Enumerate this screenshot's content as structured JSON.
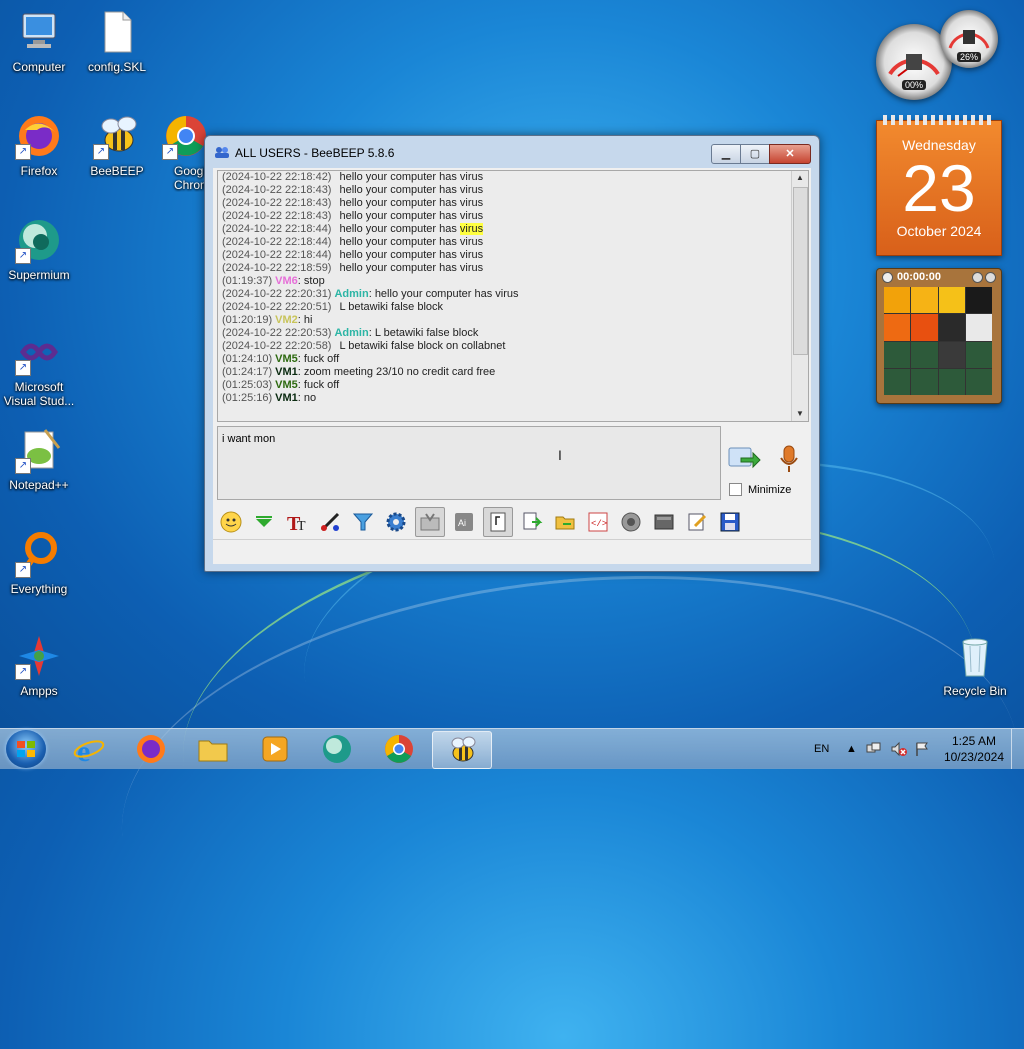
{
  "desktop": {
    "icons": [
      {
        "label": "Computer"
      },
      {
        "label": "config.SKL"
      },
      {
        "label": "Firefox"
      },
      {
        "label": "BeeBEEP"
      },
      {
        "label": "Google Chrome"
      },
      {
        "label": "Supermium"
      },
      {
        "label": "Microsoft Visual Stud..."
      },
      {
        "label": "Notepad++"
      },
      {
        "label": "Everything"
      },
      {
        "label": "Ampps"
      },
      {
        "label": "Recycle Bin"
      }
    ]
  },
  "gadgets": {
    "cpu_meter": {
      "cpu": "00%",
      "memory": "26%"
    },
    "calendar": {
      "weekday": "Wednesday",
      "day": "23",
      "month_year": "October 2024"
    },
    "puzzle": {
      "timer": "00:00:00"
    }
  },
  "window": {
    "title": "ALL USERS - BeeBEEP 5.8.6",
    "buttons": {
      "minimize": "▁",
      "maximize": "▢",
      "close": "✕"
    },
    "chat_lines": [
      {
        "ts": "(2024-10-22 22:18:42)",
        "user": "",
        "text": "hello your computer has virus"
      },
      {
        "ts": "(2024-10-22 22:18:43)",
        "user": "",
        "text": "hello your computer has virus"
      },
      {
        "ts": "(2024-10-22 22:18:43)",
        "user": "",
        "text": "hello your computer has virus"
      },
      {
        "ts": "(2024-10-22 22:18:43)",
        "user": "",
        "text": "hello your computer has virus"
      },
      {
        "ts": "(2024-10-22 22:18:44)",
        "user": "",
        "text": "hello your computer has ",
        "highlight": "virus"
      },
      {
        "ts": "(2024-10-22 22:18:44)",
        "user": "",
        "text": "hello your computer has virus"
      },
      {
        "ts": "(2024-10-22 22:18:44)",
        "user": "",
        "text": "hello your computer has virus"
      },
      {
        "ts": "(2024-10-22 22:18:59)",
        "user": "",
        "text": "hello your computer has virus"
      },
      {
        "ts": "(01:19:37)",
        "user": "VM6",
        "user_class": "u-vm6",
        "text": ": stop"
      },
      {
        "ts": "(2024-10-22 22:20:31)",
        "user": "Admin",
        "user_class": "u-admin",
        "text": ": hello your computer has virus"
      },
      {
        "ts": "(2024-10-22 22:20:51)",
        "user": "",
        "text": "L betawiki false block"
      },
      {
        "ts": "(01:20:19)",
        "user": "VM2",
        "user_class": "u-vm2",
        "text": ": hi"
      },
      {
        "ts": "(2024-10-22 22:20:53)",
        "user": "Admin",
        "user_class": "u-admin",
        "text": ": L betawiki false block"
      },
      {
        "ts": "(2024-10-22 22:20:58)",
        "user": "",
        "text": "L betawiki false block on collabnet"
      },
      {
        "ts": "(01:24:10)",
        "user": "VM5",
        "user_class": "u-vm5",
        "text": ": fuck off"
      },
      {
        "ts": "(01:24:17)",
        "user": "VM1",
        "user_class": "u-vm1",
        "text": ": zoom meeting 23/10 no credit card free"
      },
      {
        "ts": "(01:25:03)",
        "user": "VM5",
        "user_class": "u-vm5",
        "text": ": fuck off"
      },
      {
        "ts": "(01:25:16)",
        "user": "VM1",
        "user_class": "u-vm1",
        "text": ": no"
      }
    ],
    "input_text": "i want mon",
    "minimize_label": "Minimize",
    "toolbar_icons": [
      "emoji-icon",
      "green-arrow-icon",
      "font-icon",
      "color-picker-icon",
      "filter-icon",
      "settings-gear-icon",
      "inbox-icon",
      "ar-icon",
      "note-icon",
      "send-file-icon",
      "folder-share-icon",
      "code-icon",
      "record-icon",
      "screenshot-icon",
      "edit-icon",
      "save-icon"
    ]
  },
  "taskbar": {
    "language": "EN",
    "time": "1:25 AM",
    "date": "10/23/2024",
    "apps": [
      "internet-explorer",
      "firefox",
      "file-explorer",
      "media-player",
      "supermium",
      "chrome",
      "beebeep"
    ]
  }
}
